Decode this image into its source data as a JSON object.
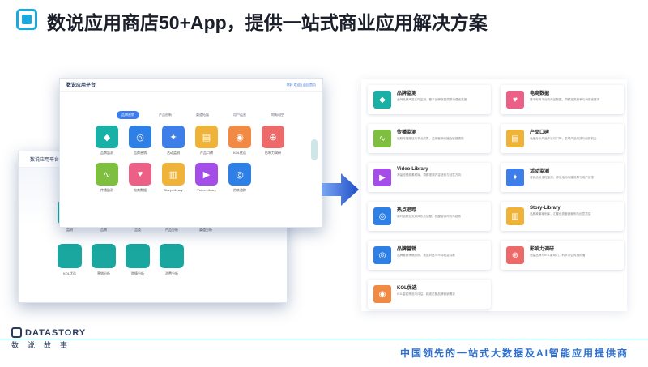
{
  "slide": {
    "title": "数说应用商店50+App，提供一站式商业应用解决方案",
    "slogan": "中国领先的一站式大数据及AI智能应用提供商",
    "brand_name": "DATASTORY",
    "brand_sub": "数说故事"
  },
  "back_shot": {
    "logo": "数说应用平台",
    "row1_labels": [
      "监测",
      "品牌",
      "品类",
      "产品分析",
      "渠道分析"
    ],
    "row1_colors": [
      "#19a7a0",
      "#1b9bb8",
      "#2f88d0",
      "#19a7a0",
      "#19a7a0"
    ],
    "row2_labels": [
      "KOL优选",
      "营销分析",
      "舆情分析",
      "消费分析"
    ],
    "row2_colors": [
      "#19a7a0",
      "#19a7a0",
      "#19a7a0",
      "#19a7a0"
    ]
  },
  "front_shot": {
    "logo": "数说应用平台",
    "user": "你好 欢迎 | 返回首页",
    "tabs": [
      "品牌营销",
      "产品创新",
      "渠道拓展",
      "用户运营",
      "舆情风控"
    ],
    "apps": [
      {
        "label": "品牌监测",
        "color": "#19b0a6",
        "icon": "◆"
      },
      {
        "label": "品牌营销",
        "color": "#2e7fe6",
        "icon": "◎"
      },
      {
        "label": "活动监测",
        "color": "#3d7ee8",
        "icon": "✦"
      },
      {
        "label": "产品口碑",
        "color": "#f0b33a",
        "icon": "▤"
      },
      {
        "label": "KOL优选",
        "color": "#f08a45",
        "icon": "◉"
      },
      {
        "label": "影响力调研",
        "color": "#ec6a6a",
        "icon": "⊕"
      },
      {
        "label": "传播监测",
        "color": "#7fbf3f",
        "icon": "∿"
      },
      {
        "label": "电商数据",
        "color": "#ec5f86",
        "icon": "♥"
      },
      {
        "label": "Story-Library",
        "color": "#f0b33a",
        "icon": "▥"
      },
      {
        "label": "Video-Library",
        "color": "#a44de8",
        "icon": "▶"
      },
      {
        "label": "热点追踪",
        "color": "#2e7fe6",
        "icon": "◎"
      }
    ]
  },
  "catalog": {
    "cards": [
      {
        "name": "品牌监测",
        "desc": "全网品牌声量实时监测，基于品牌数据洞察消费者态度",
        "color": "#19b0a6",
        "icon": "◆"
      },
      {
        "name": "电商数据",
        "desc": "基于电商平台的商品数据，洞察品类竞争与消费者需求",
        "color": "#ec5f86",
        "icon": "♥"
      },
      {
        "name": "传播监测",
        "desc": "追踪传播路径与节点效果，监测营销传播全链路表现",
        "color": "#7fbf3f",
        "icon": "∿"
      },
      {
        "name": "产品口碑",
        "desc": "深度分析产品评论与口碑，发现产品改进与创新机会",
        "color": "#f0b33a",
        "icon": "▤"
      },
      {
        "name": "Video-Library",
        "desc": "海量短视频素材库，洞察视频内容趋势与创意方向",
        "color": "#a44de8",
        "icon": "▶"
      },
      {
        "name": "活动监测",
        "desc": "营销活动全程监测，评估活动传播效果与用户反馈",
        "color": "#3d7ee8",
        "icon": "✦"
      },
      {
        "name": "热点追踪",
        "desc": "实时追踪社交媒体热点话题，把握营销时机与趋势",
        "color": "#2e7fe6",
        "icon": "◎"
      },
      {
        "name": "Story-Library",
        "desc": "品牌故事案例库，汇集优秀营销案例与创意灵感",
        "color": "#f0b33a",
        "icon": "▥"
      },
      {
        "name": "品牌营销",
        "desc": "品牌营销策略分析，竞品对比与市场机会洞察",
        "color": "#2e7fe6",
        "icon": "◎"
      },
      {
        "name": "影响力调研",
        "desc": "测量品牌与KOL影响力，科学评估传播价值",
        "color": "#ec6a6a",
        "icon": "⊕"
      },
      {
        "name": "KOL优选",
        "desc": "KOL智能筛选与评估，精准匹配品牌营销需求",
        "color": "#f08a45",
        "icon": "◉"
      }
    ]
  }
}
